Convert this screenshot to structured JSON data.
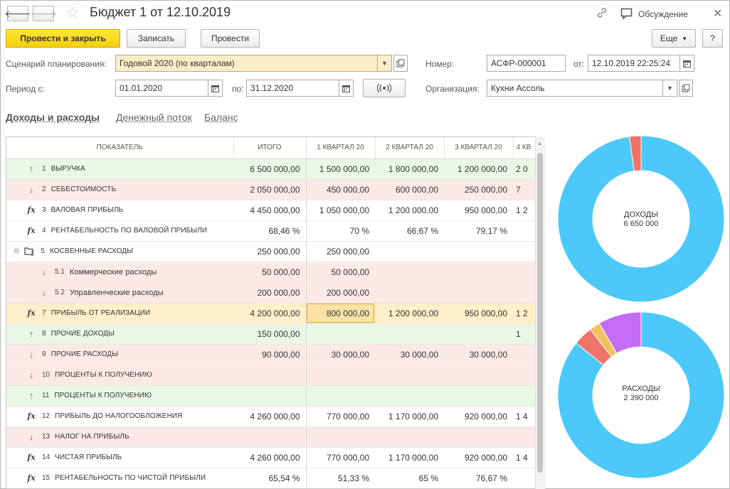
{
  "window": {
    "title": "Бюджет 1 от 12.10.2019",
    "discussion": "Обсуждение"
  },
  "toolbar": {
    "post_close": "Провести и закрыть",
    "save": "Записать",
    "post": "Провести",
    "more": "Еще",
    "help": "?"
  },
  "form": {
    "scenario_label": "Сценарий планирования:",
    "scenario_value": "Годовой 2020 (по кварталам)",
    "number_label": "Номер:",
    "number_value": "АСФР-000001",
    "date_label": "от:",
    "date_value": "12.10.2019 22:25:24",
    "period_label": "Период с:",
    "period_from": "01.01.2020",
    "period_to_label": "по:",
    "period_to": "31.12.2020",
    "org_label": "Организация:",
    "org_value": "Кухни Ассоль"
  },
  "tabs": [
    {
      "label": "Доходы и расходы",
      "active": true
    },
    {
      "label": "Денежный поток",
      "active": false
    },
    {
      "label": "Баланс",
      "active": false
    }
  ],
  "table": {
    "headers": [
      "ПОКАЗАТЕЛЬ",
      "ИТОГО",
      "1 КВАРТАЛ 20",
      "2 КВАРТАЛ 20",
      "3 КВАРТАЛ 20",
      "4 КВ"
    ],
    "rows": [
      {
        "icon": "up",
        "num": "1",
        "name": "ВЫРУЧКА",
        "color": "green",
        "total": "6 500 000,00",
        "q1": "1 500 000,00",
        "q2": "1 800 000,00",
        "q3": "1 200 000,00",
        "q4": "2 0"
      },
      {
        "icon": "down",
        "num": "2",
        "name": "СЕБЕСТОИМОСТЬ",
        "color": "pink",
        "total": "2 050 000,00",
        "q1": "450 000,00",
        "q2": "600 000,00",
        "q3": "250 000,00",
        "q4": "7"
      },
      {
        "icon": "fx",
        "num": "3",
        "name": "ВАЛОВАЯ ПРИБЫЛЬ",
        "color": "white",
        "total": "4 450 000,00",
        "q1": "1 050 000,00",
        "q2": "1 200 000,00",
        "q3": "950 000,00",
        "q4": "1 2"
      },
      {
        "icon": "fx",
        "num": "4",
        "name": "РЕНТАБЕЛЬНОСТЬ ПО ВАЛОВОЙ ПРИБЫЛИ",
        "color": "white",
        "total": "68,46 %",
        "q1": "70 %",
        "q2": "66,67 %",
        "q3": "79,17 %",
        "q4": ""
      },
      {
        "icon": "group",
        "num": "5",
        "name": "КОСВЕННЫЕ РАСХОДЫ",
        "color": "white",
        "total": "250 000,00",
        "q1": "250 000,00",
        "q2": "",
        "q3": "",
        "q4": ""
      },
      {
        "icon": "down",
        "num": "5.1",
        "name": "Коммерческие расходы",
        "color": "pink",
        "sub": true,
        "total": "50 000,00",
        "q1": "50 000,00",
        "q2": "",
        "q3": "",
        "q4": ""
      },
      {
        "icon": "down",
        "num": "5.2",
        "name": "Управленческие расходы",
        "color": "pink",
        "sub": true,
        "total": "200 000,00",
        "q1": "200 000,00",
        "q2": "",
        "q3": "",
        "q4": ""
      },
      {
        "icon": "fx",
        "num": "7",
        "name": "ПРИБЫЛЬ ОТ РЕАЛИЗАЦИИ",
        "color": "yellow",
        "total": "4 200 000,00",
        "q1": "800 000,00",
        "q2": "1 200 000,00",
        "q3": "950 000,00",
        "q4": "1 2",
        "selected": "q1"
      },
      {
        "icon": "up",
        "num": "8",
        "name": "ПРОЧИЕ ДОХОДЫ",
        "color": "green",
        "total": "150 000,00",
        "q1": "",
        "q2": "",
        "q3": "",
        "q4": "1"
      },
      {
        "icon": "down",
        "num": "9",
        "name": "ПРОЧИЕ РАСХОДЫ",
        "color": "pink",
        "total": "90 000,00",
        "q1": "30 000,00",
        "q2": "30 000,00",
        "q3": "30 000,00",
        "q4": ""
      },
      {
        "icon": "down",
        "num": "10",
        "name": "ПРОЦЕНТЫ К ПОЛУЧЕНИЮ",
        "color": "pink",
        "total": "",
        "q1": "",
        "q2": "",
        "q3": "",
        "q4": ""
      },
      {
        "icon": "up",
        "num": "11",
        "name": "ПРОЦЕНТЫ К ПОЛУЧЕНИЮ",
        "color": "green",
        "total": "",
        "q1": "",
        "q2": "",
        "q3": "",
        "q4": ""
      },
      {
        "icon": "fx",
        "num": "12",
        "name": "ПРИБЫЛЬ ДО НАЛОГООБЛОЖЕНИЯ",
        "color": "white",
        "total": "4 260 000,00",
        "q1": "770 000,00",
        "q2": "1 170 000,00",
        "q3": "920 000,00",
        "q4": "1 4"
      },
      {
        "icon": "down",
        "num": "13",
        "name": "НАЛОГ НА ПРИБЫЛЬ",
        "color": "pink",
        "total": "",
        "q1": "",
        "q2": "",
        "q3": "",
        "q4": ""
      },
      {
        "icon": "fx",
        "num": "14",
        "name": "ЧИСТАЯ ПРИБЫЛЬ",
        "color": "white",
        "total": "4 260 000,00",
        "q1": "770 000,00",
        "q2": "1 170 000,00",
        "q3": "920 000,00",
        "q4": "1 4"
      },
      {
        "icon": "fx",
        "num": "15",
        "name": "РЕНТАБЕЛЬНОСТЬ ПО ЧИСТОЙ ПРИБЫЛИ",
        "color": "white",
        "total": "65,54 %",
        "q1": "51,33 %",
        "q2": "65 %",
        "q3": "76,67 %",
        "q4": ""
      }
    ]
  },
  "chart_data": [
    {
      "type": "pie",
      "title": "ДОХОДЫ",
      "subtitle": "6 650 000",
      "slices": [
        {
          "value": 6500000,
          "color": "#4cc8fa"
        },
        {
          "value": 150000,
          "color": "#f0736a"
        }
      ]
    },
    {
      "type": "pie",
      "title": "РАСХОДЫ",
      "subtitle": "2 390 000",
      "slices": [
        {
          "value": 2050000,
          "color": "#4cc8fa"
        },
        {
          "value": 90000,
          "color": "#f0736a"
        },
        {
          "value": 50000,
          "color": "#f2c25f"
        },
        {
          "value": 200000,
          "color": "#c36cf5"
        }
      ]
    }
  ]
}
